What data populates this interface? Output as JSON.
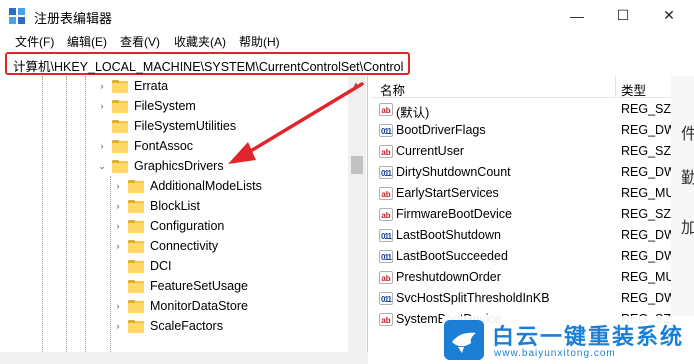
{
  "window": {
    "title": "注册表编辑器",
    "minimize_glyph": "—",
    "maximize_glyph": "☐",
    "close_glyph": "✕"
  },
  "menu": [
    {
      "label": "文件(F)"
    },
    {
      "label": "编辑(E)"
    },
    {
      "label": "查看(V)"
    },
    {
      "label": "收藏夹(A)"
    },
    {
      "label": "帮助(H)"
    }
  ],
  "address": {
    "path": "计算机\\HKEY_LOCAL_MACHINE\\SYSTEM\\CurrentControlSet\\Control"
  },
  "tree": {
    "items": [
      {
        "label": "Errata",
        "expander": "›"
      },
      {
        "label": "FileSystem",
        "expander": "›"
      },
      {
        "label": "FileSystemUtilities",
        "expander": ""
      },
      {
        "label": "FontAssoc",
        "expander": "›"
      },
      {
        "label": "GraphicsDrivers",
        "expander": "⌄"
      },
      {
        "label": "AdditionalModeLists",
        "expander": "›"
      },
      {
        "label": "BlockList",
        "expander": "›"
      },
      {
        "label": "Configuration",
        "expander": "›"
      },
      {
        "label": "Connectivity",
        "expander": "›"
      },
      {
        "label": "DCI",
        "expander": ""
      },
      {
        "label": "FeatureSetUsage",
        "expander": ""
      },
      {
        "label": "MonitorDataStore",
        "expander": "›"
      },
      {
        "label": "ScaleFactors",
        "expander": "›"
      }
    ]
  },
  "list": {
    "columns": {
      "name": "名称",
      "type": "类型"
    },
    "rows": [
      {
        "icon": "ab",
        "name": "(默认)",
        "type": "REG_SZ"
      },
      {
        "icon": "011",
        "name": "BootDriverFlags",
        "type": "REG_DW"
      },
      {
        "icon": "ab",
        "name": "CurrentUser",
        "type": "REG_SZ"
      },
      {
        "icon": "011",
        "name": "DirtyShutdownCount",
        "type": "REG_DW"
      },
      {
        "icon": "ab",
        "name": "EarlyStartServices",
        "type": "REG_MU"
      },
      {
        "icon": "ab",
        "name": "FirmwareBootDevice",
        "type": "REG_SZ"
      },
      {
        "icon": "011",
        "name": "LastBootShutdown",
        "type": "REG_DW"
      },
      {
        "icon": "011",
        "name": "LastBootSucceeded",
        "type": "REG_DW"
      },
      {
        "icon": "ab",
        "name": "PreshutdownOrder",
        "type": "REG_MU"
      },
      {
        "icon": "011",
        "name": "SvcHostSplitThresholdInKB",
        "type": "REG_DW"
      },
      {
        "icon": "ab",
        "name": "SystemBootDevice",
        "type": "REG_SZ"
      }
    ]
  },
  "right_strip_chars": [
    "件",
    "勤",
    "加"
  ],
  "watermark": {
    "title": "白云一键重装系统",
    "url": "www.baiyunxitong.com"
  },
  "colors": {
    "highlight_red": "#e0262a",
    "brand_blue": "#1c7fd6",
    "folder_yellow": "#ffd76a"
  }
}
